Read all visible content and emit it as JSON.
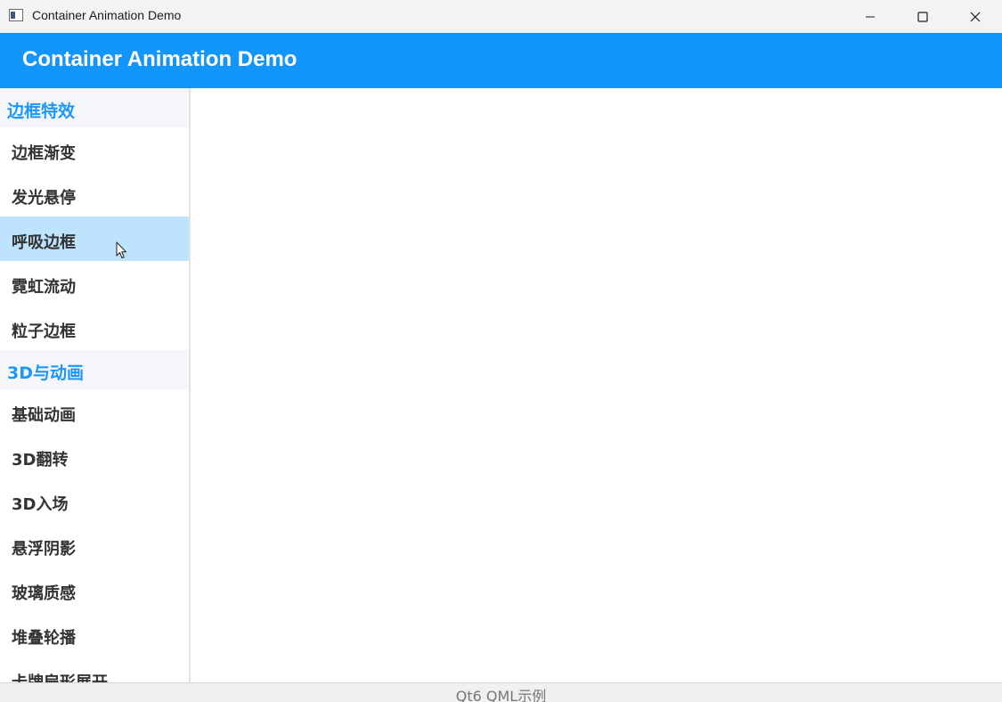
{
  "window": {
    "title": "Container Animation Demo",
    "controls": {
      "minimize_icon": "minimize-icon",
      "maximize_icon": "maximize-icon",
      "close_icon": "close-icon"
    }
  },
  "header": {
    "title": "Container Animation Demo",
    "background": "#1296fb"
  },
  "sidebar": {
    "sections": [
      {
        "title": "边框特效",
        "items": [
          {
            "label": "边框渐变"
          },
          {
            "label": "发光悬停"
          },
          {
            "label": "呼吸边框",
            "selected": true
          },
          {
            "label": "霓虹流动"
          },
          {
            "label": "粒子边框"
          }
        ]
      },
      {
        "title": "3D与动画",
        "items": [
          {
            "label": "基础动画"
          },
          {
            "label": "3D翻转"
          },
          {
            "label": "3D入场"
          },
          {
            "label": "悬浮阴影"
          },
          {
            "label": "玻璃质感"
          },
          {
            "label": "堆叠轮播"
          },
          {
            "label": "卡牌扇形展开"
          }
        ]
      }
    ],
    "accent": "#1e96f5",
    "selected_bg": "#bde4fc"
  },
  "footer": {
    "text": "Qt6 QML示例"
  }
}
